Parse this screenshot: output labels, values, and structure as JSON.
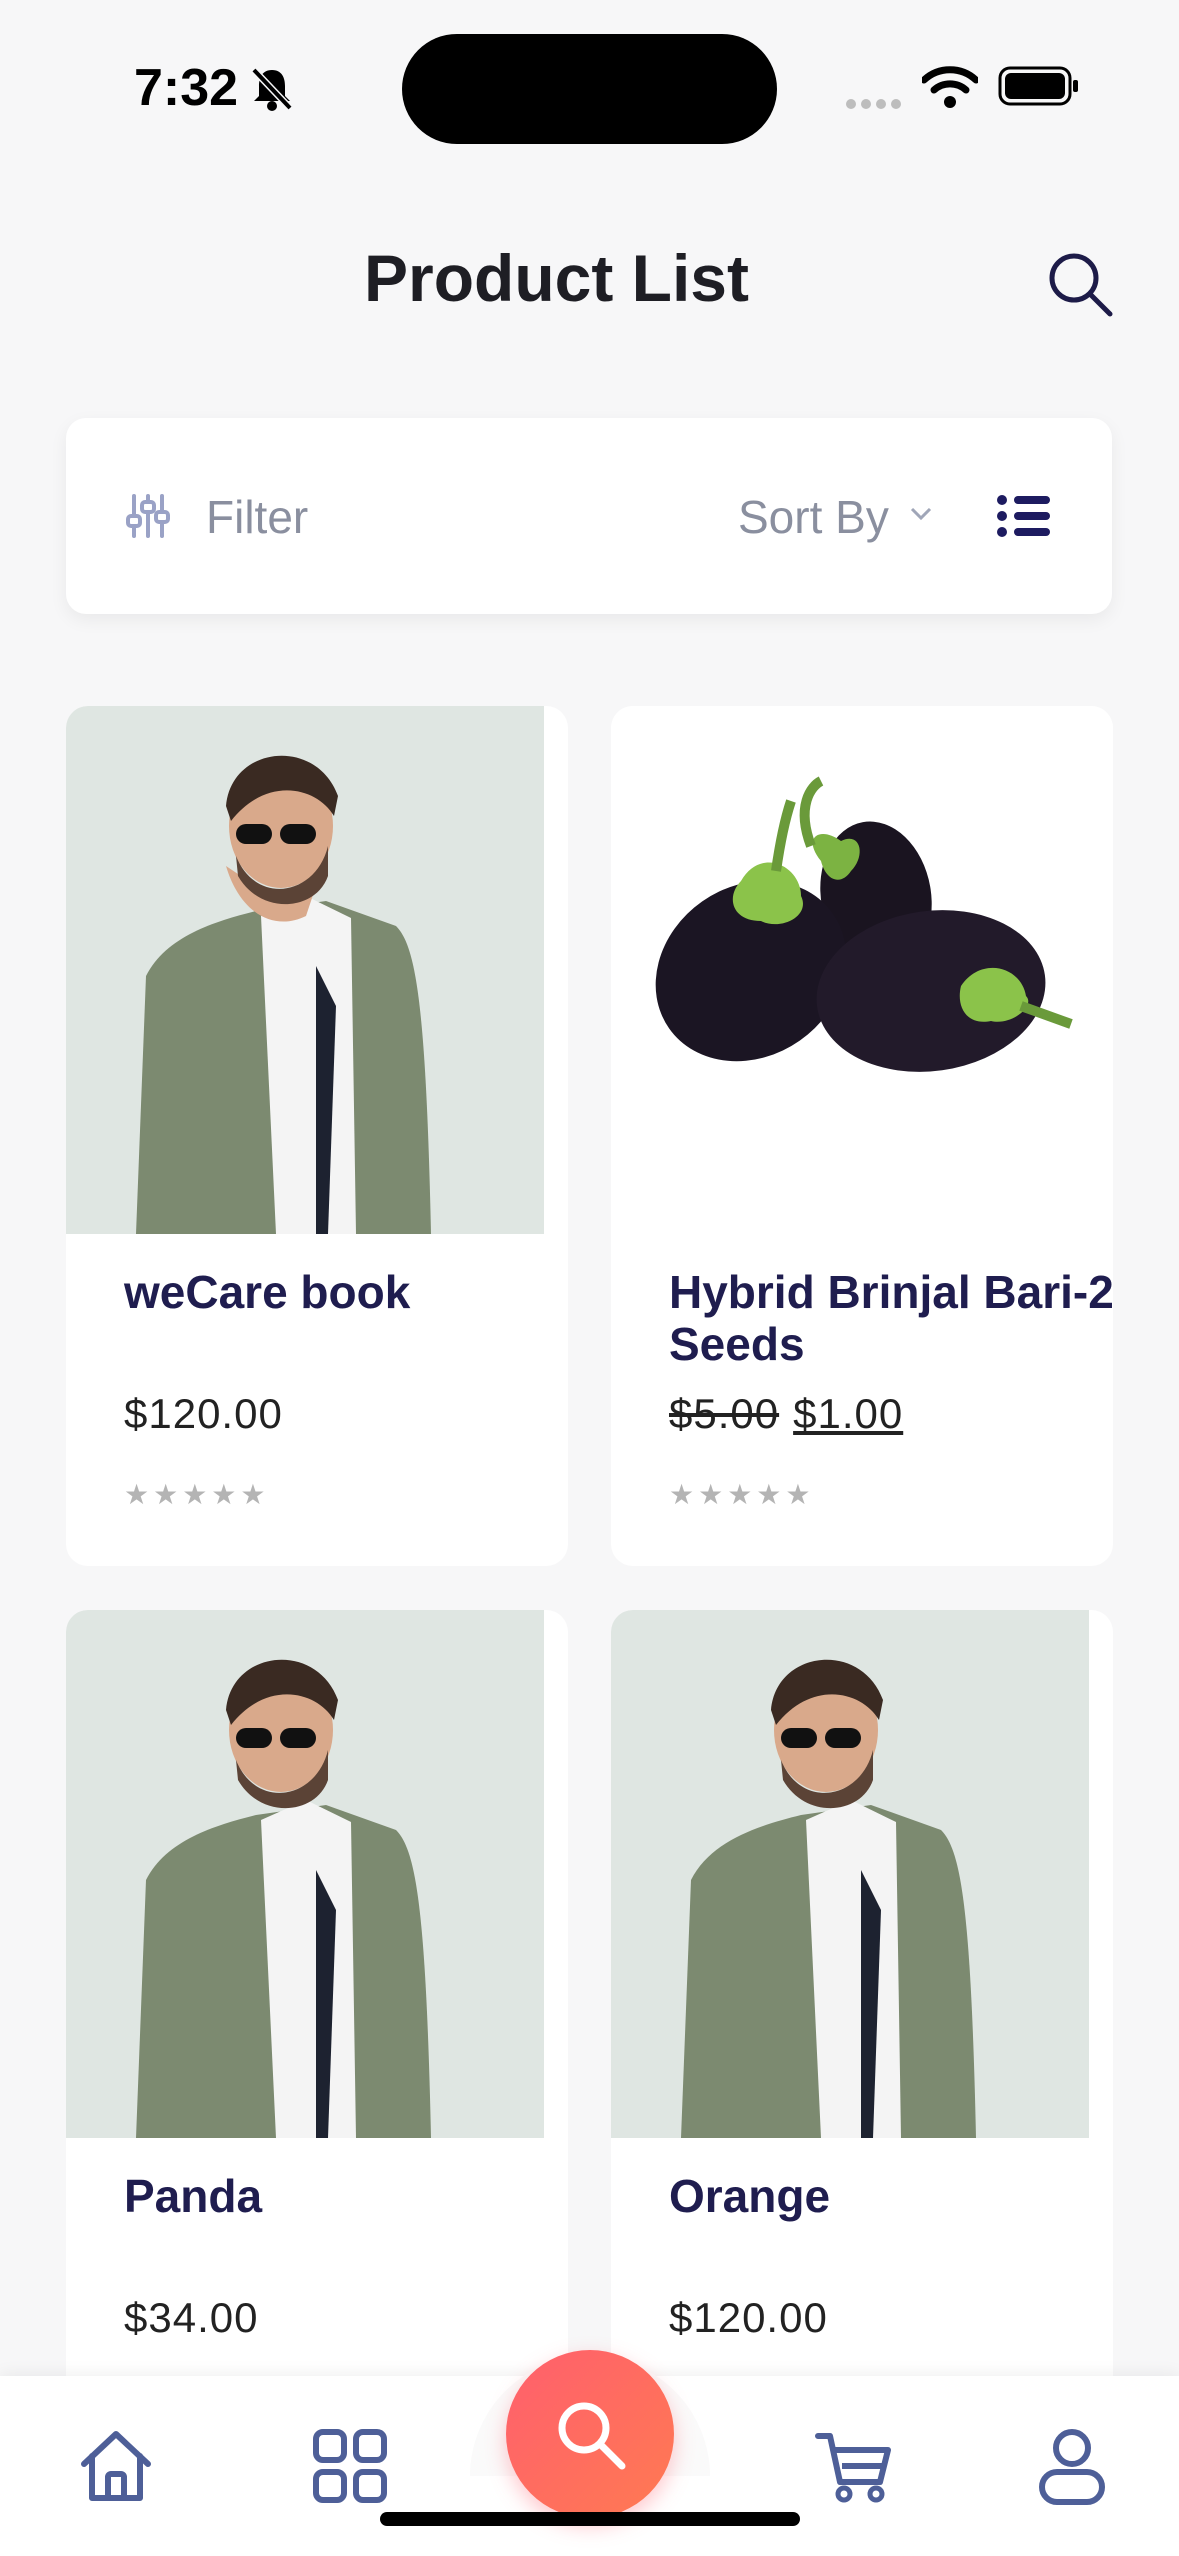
{
  "status": {
    "time": "7:32"
  },
  "header": {
    "title": "Product List"
  },
  "filter_bar": {
    "filter_label": "Filter",
    "sort_label": "Sort By"
  },
  "products": [
    {
      "name": "weCare book",
      "price": "$120.00",
      "rating": "★★★★★"
    },
    {
      "name": "Hybrid Brinjal Bari-2 Seeds",
      "old_price": "$5.00",
      "price": "$1.00",
      "rating": "★★★★★"
    },
    {
      "name": "Panda",
      "price": "$34.00"
    },
    {
      "name": "Orange",
      "price": "$120.00"
    }
  ],
  "bottom_nav": {
    "items": [
      "home-icon",
      "categories-icon",
      "search-icon",
      "cart-icon",
      "profile-icon"
    ]
  },
  "colors": {
    "accent": "#ff6b60",
    "nav_icon": "#4e5f98",
    "title": "#1f1d4f"
  }
}
